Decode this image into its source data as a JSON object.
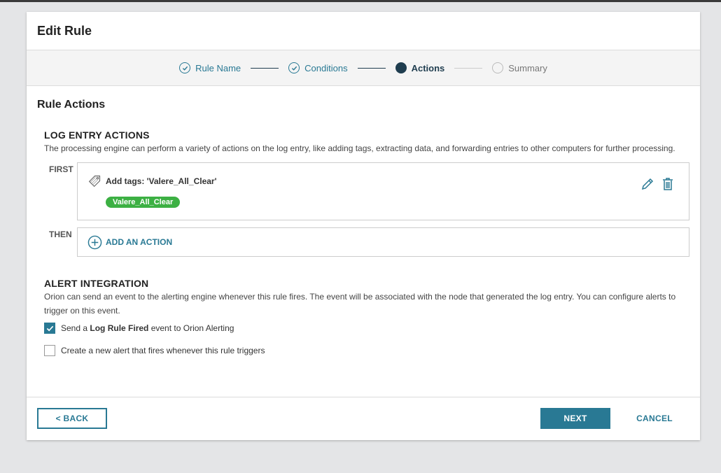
{
  "dialog": {
    "title": "Edit Rule"
  },
  "stepper": {
    "steps": [
      {
        "label": "Rule Name",
        "state": "done"
      },
      {
        "label": "Conditions",
        "state": "done"
      },
      {
        "label": "Actions",
        "state": "active"
      },
      {
        "label": "Summary",
        "state": "todo"
      }
    ]
  },
  "rule_actions": {
    "title": "Rule Actions",
    "log_entry": {
      "heading": "LOG ENTRY ACTIONS",
      "description": "The processing engine can perform a variety of actions on the log entry, like adding tags, extracting data, and forwarding entries to other computers for further processing.",
      "first_label": "FIRST",
      "first_action_title": "Add tags: 'Valere_All_Clear'",
      "first_action_tag": "Valere_All_Clear",
      "then_label": "THEN",
      "add_action_label": "ADD AN ACTION"
    },
    "alert": {
      "heading": "ALERT INTEGRATION",
      "description": "Orion can send an event to the alerting engine whenever this rule fires. The event will be associated with the node that generated the log entry. You can configure alerts to trigger on this event.",
      "opt1_prefix": "Send a ",
      "opt1_bold": "Log Rule Fired",
      "opt1_suffix": " event to Orion Alerting",
      "opt1_checked": true,
      "opt2_label": "Create a new alert that fires whenever this rule triggers",
      "opt2_checked": false
    }
  },
  "footer": {
    "back_label": "< BACK",
    "next_label": "NEXT",
    "cancel_label": "CANCEL"
  },
  "colors": {
    "accent": "#297994",
    "dark": "#1f3d4f",
    "tag_green": "#3cb043"
  },
  "icons": {
    "done": "check-circle-icon",
    "tag": "tag-icon",
    "edit": "pencil-icon",
    "delete": "trash-icon",
    "add": "plus-circle-icon",
    "checkbox": "checkmark-icon"
  }
}
